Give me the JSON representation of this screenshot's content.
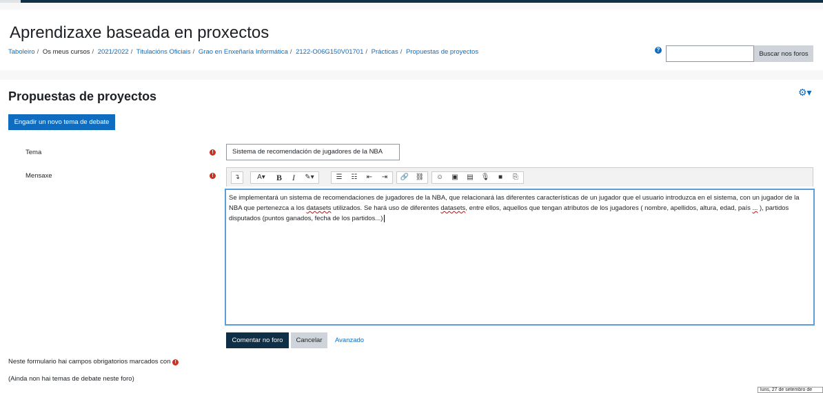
{
  "course": {
    "title": "Aprendizaxe baseada en proxectos"
  },
  "breadcrumb": [
    "Taboleiro",
    "Os meus cursos",
    "2021/2022",
    "Titulacións Oficiais",
    "Grao en Enxeñaría Informática",
    "2122-O06G150V01701",
    "Prácticas",
    "Propuestas de proyectos"
  ],
  "search": {
    "value": "",
    "button_label": "Buscar nos foros"
  },
  "forum": {
    "title": "Propuestas de proyectos",
    "add_button": "Engadir un novo tema de debate"
  },
  "form": {
    "subject_label": "Tema",
    "subject_value": "Sistema de recomendación de jugadores de la NBA",
    "message_label": "Mensaxe",
    "message_parts": [
      "Se implementará un sistema de recomendaciones de jugadores de la NBA, que relacionará las diferentes características de un jugador que el usuario introduzca en el sistema, con un jugador de la NBA que pertenezca a los ",
      "datasets",
      " utilizados. Se hará uso de diferentes ",
      "datasets",
      ", entre ellos, aquellos que tengan atributos de los jugadores ( nombre, apellidos, altura, edad, país ",
      "...",
      " ), partidos disputados (puntos ganados, fecha de los partidos...)"
    ],
    "submit_label": "Comentar no foro",
    "cancel_label": "Cancelar",
    "advanced_label": "Avanzado",
    "required_note": "Neste formulario hai campos obrigatorios marcados con",
    "no_topics_note": "(Ainda non hai temas de debate neste foro)"
  },
  "toolbar_icons": [
    "collapse-icon",
    "font-color-icon",
    "bold-icon",
    "italic-icon",
    "style-icon",
    "bullet-list-icon",
    "numbered-list-icon",
    "outdent-icon",
    "indent-icon",
    "link-icon",
    "unlink-icon",
    "emoji-icon",
    "image-icon",
    "media-icon",
    "record-audio-icon",
    "record-video-icon",
    "manage-files-icon"
  ],
  "colors": {
    "primary": "#0f6cbf",
    "dark": "#0f2f47",
    "required": "#ca3120"
  },
  "footer": {
    "date": "luns, 27 de setembro de"
  }
}
